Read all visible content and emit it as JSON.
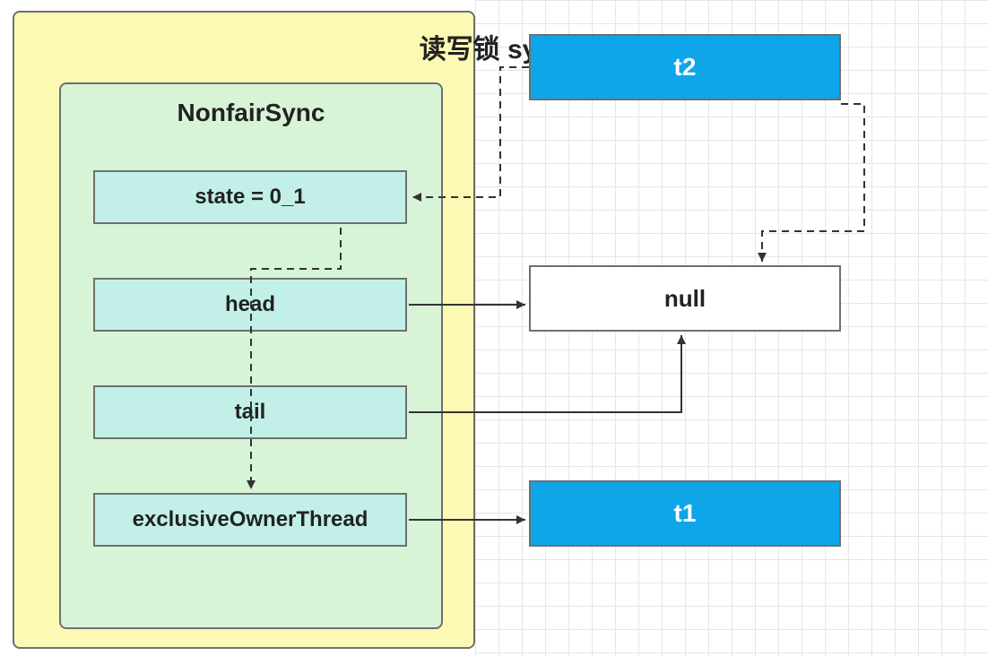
{
  "outer": {
    "title": "读写锁 sync"
  },
  "inner": {
    "title": "NonfairSync"
  },
  "fields": {
    "state": "state = 0_1",
    "head": "head",
    "tail": "tail",
    "exclusiveOwnerThread": "exclusiveOwnerThread"
  },
  "nodes": {
    "t2": "t2",
    "null": "null",
    "t1": "t1"
  },
  "chart_data": {
    "type": "diagram",
    "title": "读写锁 sync",
    "container": {
      "name": "读写锁 sync",
      "child": {
        "name": "NonfairSync",
        "fields": [
          "state = 0_1",
          "head",
          "tail",
          "exclusiveOwnerThread"
        ]
      }
    },
    "external_nodes": [
      "t2",
      "null",
      "t1"
    ],
    "edges": [
      {
        "from": "t2",
        "to": "state = 0_1",
        "style": "dashed"
      },
      {
        "from": "t2",
        "to": "null",
        "style": "dashed"
      },
      {
        "from": "head",
        "to": "null",
        "style": "solid"
      },
      {
        "from": "tail",
        "to": "null",
        "style": "solid"
      },
      {
        "from": "head",
        "to": "exclusiveOwnerThread",
        "style": "dashed",
        "label_via": "internal"
      },
      {
        "from": "exclusiveOwnerThread",
        "to": "t1",
        "style": "solid"
      }
    ]
  }
}
